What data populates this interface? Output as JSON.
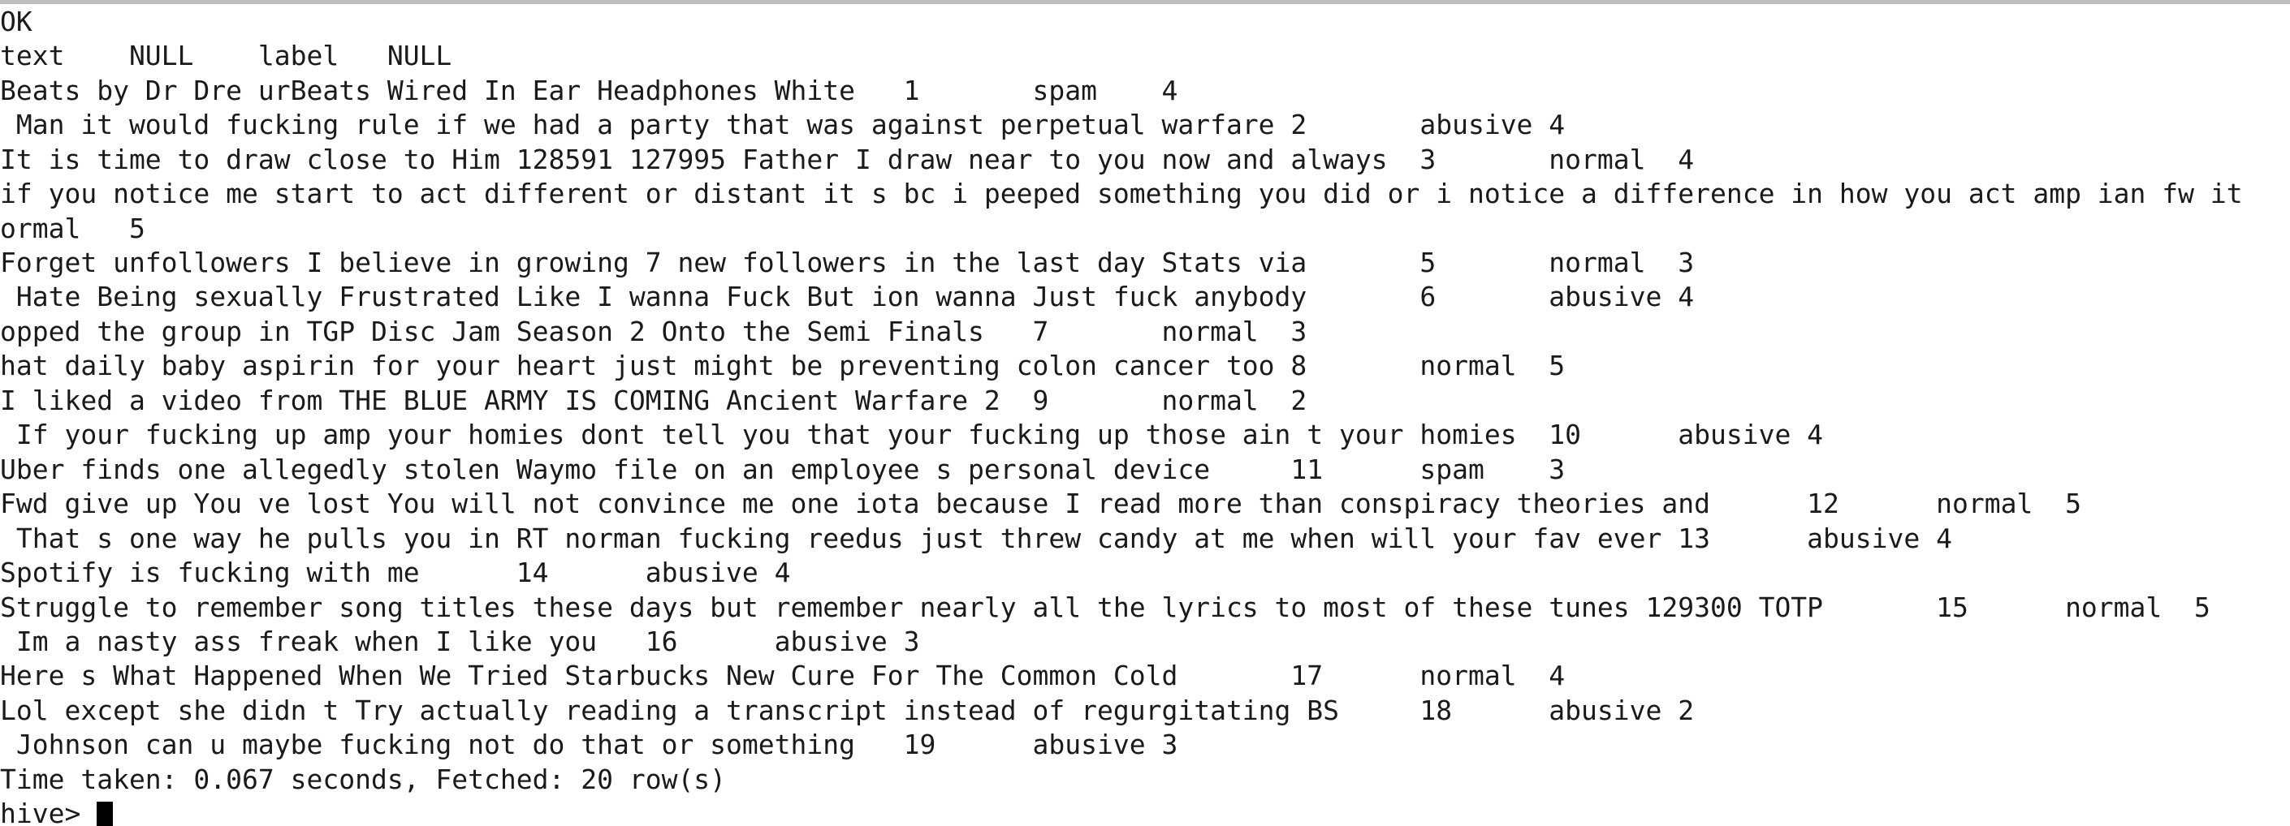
{
  "terminal": {
    "status": "OK",
    "header": "text    NULL    label   NULL",
    "rows": [
      "Beats by Dr Dre urBeats Wired In Ear Headphones White   1       spam    4",
      " Man it would fucking rule if we had a party that was against perpetual warfare 2       abusive 4",
      "It is time to draw close to Him 128591 127995 Father I draw near to you now and always  3       normal  4",
      "if you notice me start to act different or distant it s bc i peeped something you did or i notice a difference in how you act amp ian fw it",
      "ormal   5",
      "Forget unfollowers I believe in growing 7 new followers in the last day Stats via       5       normal  3",
      " Hate Being sexually Frustrated Like I wanna Fuck But ion wanna Just fuck anybody       6       abusive 4",
      "opped the group in TGP Disc Jam Season 2 Onto the Semi Finals   7       normal  3",
      "hat daily baby aspirin for your heart just might be preventing colon cancer too 8       normal  5",
      "I liked a video from THE BLUE ARMY IS COMING Ancient Warfare 2  9       normal  2",
      " If your fucking up amp your homies dont tell you that your fucking up those ain t your homies  10      abusive 4",
      "Uber finds one allegedly stolen Waymo file on an employee s personal device     11      spam    3",
      "Fwd give up You ve lost You will not convince me one iota because I read more than conspiracy theories and      12      normal  5",
      " That s one way he pulls you in RT norman fucking reedus just threw candy at me when will your fav ever 13      abusive 4",
      "Spotify is fucking with me      14      abusive 4",
      "Struggle to remember song titles these days but remember nearly all the lyrics to most of these tunes 129300 TOTP       15      normal  5",
      " Im a nasty ass freak when I like you   16      abusive 3",
      "Here s What Happened When We Tried Starbucks New Cure For The Common Cold       17      normal  4",
      "Lol except she didn t Try actually reading a transcript instead of regurgitating BS     18      abusive 2",
      " Johnson can u maybe fucking not do that or something   19      abusive 3"
    ],
    "footer": "Time taken: 0.067 seconds, Fetched: 20 row(s)",
    "prompt": "hive> "
  }
}
